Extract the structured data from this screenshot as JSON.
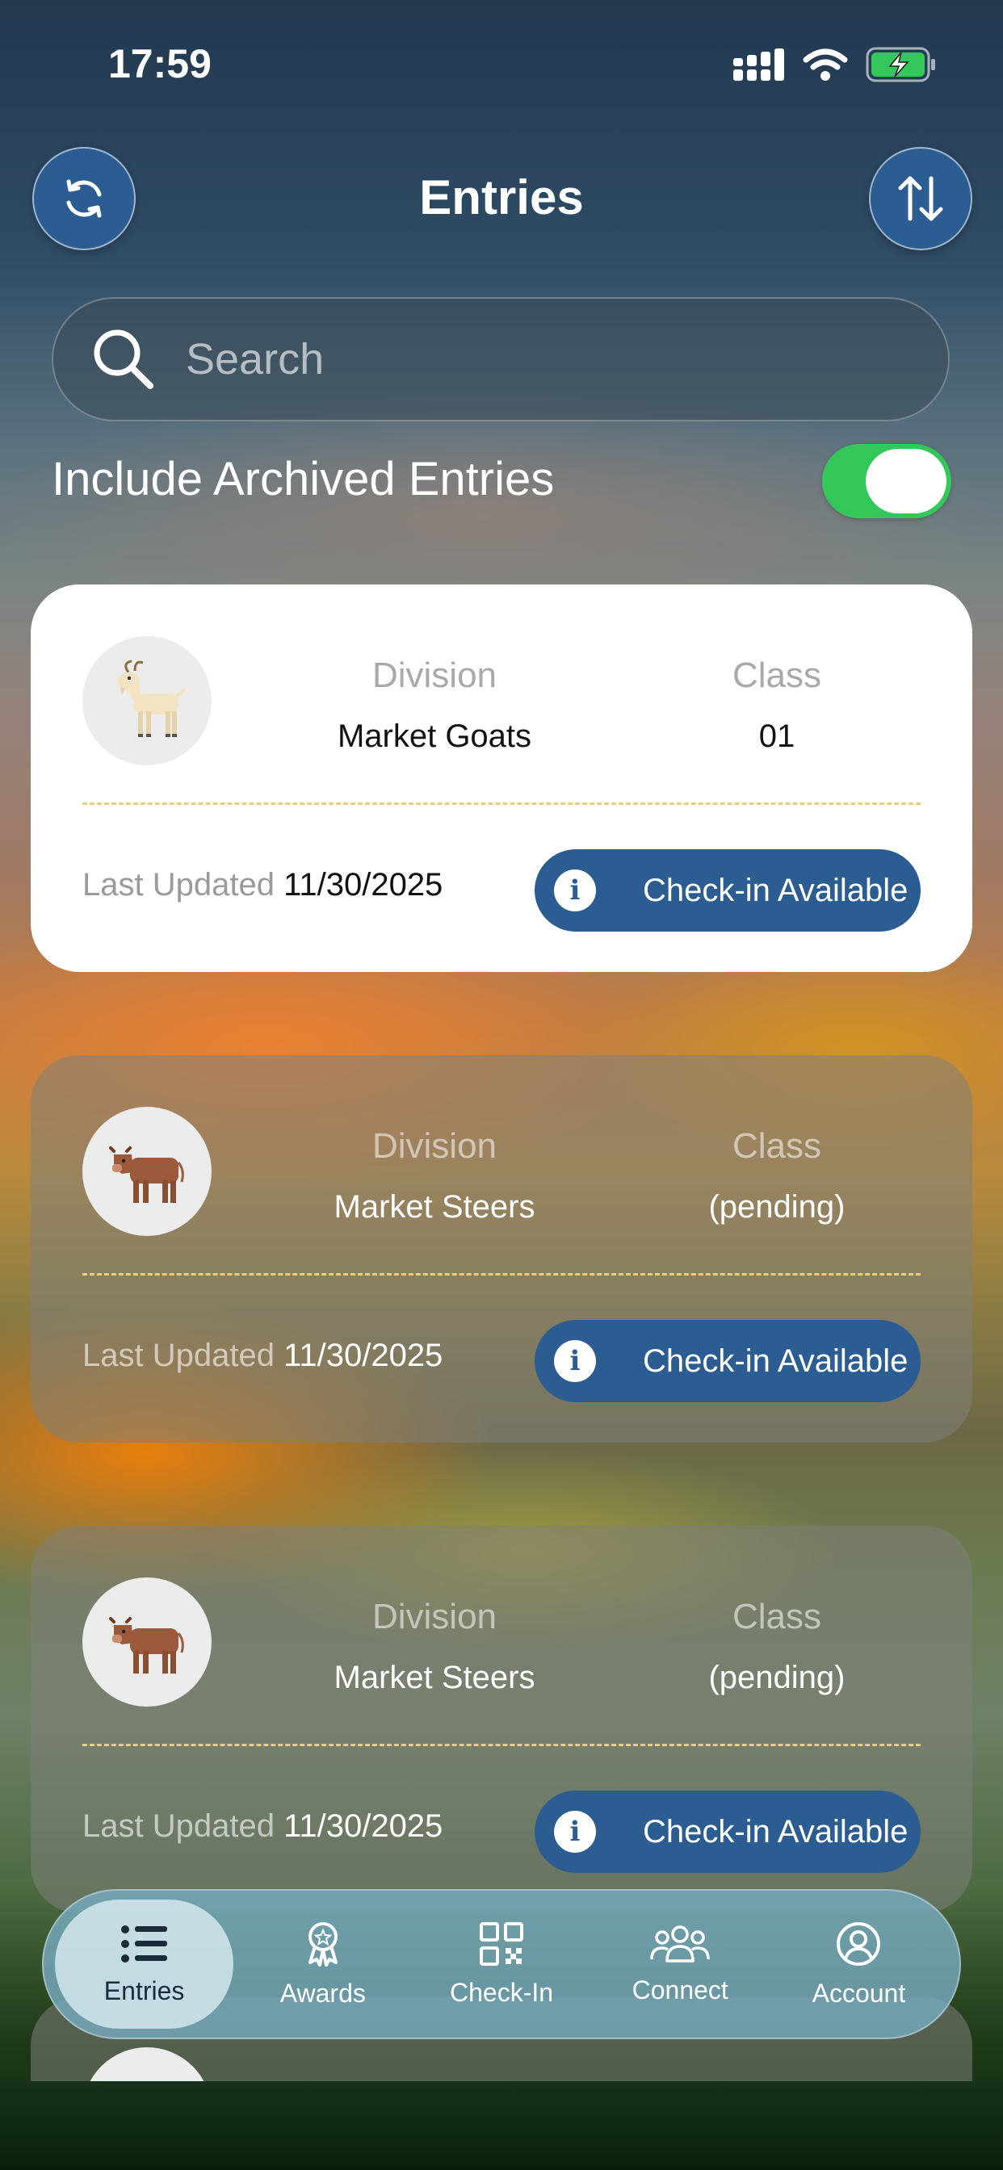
{
  "status_bar": {
    "time": "17:59",
    "battery": "charging"
  },
  "header": {
    "title": "Entries",
    "left_button": "refresh-icon",
    "right_button": "sort-icon"
  },
  "search": {
    "placeholder": "Search",
    "value": ""
  },
  "archived_toggle": {
    "label": "Include Archived Entries",
    "on": true
  },
  "cards": [
    {
      "animal": "goat",
      "division_label": "Division",
      "division": "Market Goats",
      "class_label": "Class",
      "class": "01",
      "updated_label": "Last Updated",
      "updated": "11/30/2025",
      "status": "Check-in Available"
    },
    {
      "animal": "steer",
      "division_label": "Division",
      "division": "Market Steers",
      "class_label": "Class",
      "class": "(pending)",
      "updated_label": "Last Updated",
      "updated": "11/30/2025",
      "status": "Check-in Available"
    },
    {
      "animal": "steer",
      "division_label": "Division",
      "division": "Market Steers",
      "class_label": "Class",
      "class": "(pending)",
      "updated_label": "Last Updated",
      "updated": "11/30/2025",
      "status": "Check-in Available"
    }
  ],
  "tabs": [
    {
      "label": "Entries",
      "icon": "list-icon",
      "active": true
    },
    {
      "label": "Awards",
      "icon": "award-icon",
      "active": false
    },
    {
      "label": "Check-In",
      "icon": "qr-code-icon",
      "active": false
    },
    {
      "label": "Connect",
      "icon": "people-icon",
      "active": false
    },
    {
      "label": "Account",
      "icon": "account-icon",
      "active": false
    }
  ],
  "colors": {
    "accent": "#2B5D92",
    "toggle_on": "#34C759",
    "divider": "#E8CF7A"
  }
}
